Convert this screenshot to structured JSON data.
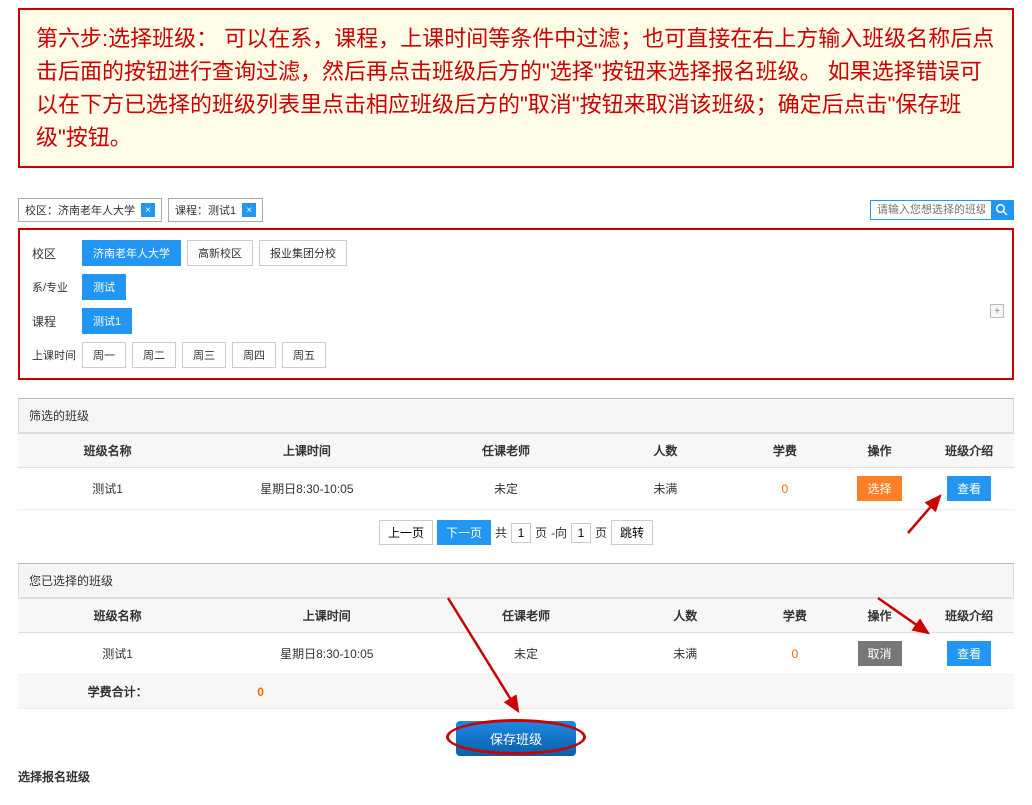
{
  "instruction": "第六步:选择班级： 可以在系，课程，上课时间等条件中过滤；也可直接在右上方输入班级名称后点击后面的按钮进行查询过滤，然后再点击班级后方的\"选择\"按钮来选择报名班级。 如果选择错误可以在下方已选择的班级列表里点击相应班级后方的\"取消\"按钮来取消该班级；确定后点击\"保存班级\"按钮。",
  "tags": {
    "campus": "校区：济南老年人大学",
    "course": "课程：测试1"
  },
  "search": {
    "placeholder": "请输入您想选择的班级"
  },
  "filter": {
    "campus_label": "校区",
    "campus_opts": [
      "济南老年人大学",
      "高新校区",
      "报业集团分校"
    ],
    "dept_label": "系/专业",
    "dept_opts": [
      "测试"
    ],
    "course_label": "课程",
    "course_opts": [
      "测试1"
    ],
    "time_label": "上课时间",
    "time_opts": [
      "周一",
      "周二",
      "周三",
      "周四",
      "周五"
    ]
  },
  "filtered": {
    "title": "筛选的班级",
    "headers": {
      "name": "班级名称",
      "time": "上课时间",
      "teacher": "任课老师",
      "count": "人数",
      "fee": "学费",
      "op": "操作",
      "intro": "班级介绍"
    },
    "row": {
      "name": "测试1",
      "time": "星期日8:30-10:05",
      "teacher": "未定",
      "count": "未满",
      "fee": "0",
      "select": "选择",
      "view": "查看"
    }
  },
  "pager": {
    "prev": "上一页",
    "next": "下一页",
    "gong": "共",
    "ye": "页",
    "xiang": "-向",
    "current": "1",
    "total": "1",
    "jump": "跳转"
  },
  "selected": {
    "title": "您已选择的班级",
    "headers": {
      "name": "班级名称",
      "time": "上课时间",
      "teacher": "任课老师",
      "count": "人数",
      "fee": "学费",
      "op": "操作",
      "intro": "班级介绍"
    },
    "row": {
      "name": "测试1",
      "time": "星期日8:30-10:05",
      "teacher": "未定",
      "count": "未满",
      "fee": "0",
      "cancel": "取消",
      "view": "查看"
    },
    "sum_label": "学费合计：",
    "sum_value": "0"
  },
  "save": "保存班级",
  "footer": "选择报名班级"
}
